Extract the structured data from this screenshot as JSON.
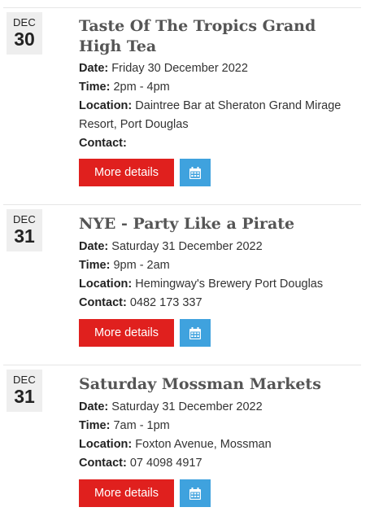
{
  "events": [
    {
      "month": "DEC",
      "day": "30",
      "title": "Taste Of The Tropics Grand High Tea",
      "date_label": "Date:",
      "date_value": "Friday 30 December 2022",
      "time_label": "Time:",
      "time_value": "2pm - 4pm",
      "location_label": "Location:",
      "location_value": "Daintree Bar at Sheraton Grand Mirage Resort, Port Douglas",
      "contact_label": "Contact:",
      "contact_value": "",
      "more_label": "More details",
      "calendar_icon": "calendar-icon"
    },
    {
      "month": "DEC",
      "day": "31",
      "title": "NYE - Party Like a Pirate",
      "date_label": "Date:",
      "date_value": "Saturday 31 December 2022",
      "time_label": "Time:",
      "time_value": "9pm - 2am",
      "location_label": "Location:",
      "location_value": "Hemingway's Brewery Port Douglas",
      "contact_label": "Contact:",
      "contact_value": "0482 173 337",
      "more_label": "More details",
      "calendar_icon": "calendar-icon"
    },
    {
      "month": "DEC",
      "day": "31",
      "title": "Saturday Mossman Markets",
      "date_label": "Date:",
      "date_value": "Saturday 31 December 2022",
      "time_label": "Time:",
      "time_value": "7am - 1pm",
      "location_label": "Location:",
      "location_value": "Foxton Avenue, Mossman",
      "contact_label": "Contact:",
      "contact_value": "07 4098 4917",
      "more_label": "More details",
      "calendar_icon": "calendar-icon"
    }
  ],
  "colors": {
    "more_button": "#e0201e",
    "calendar_button": "#3fa2de",
    "date_box": "#eeeeee",
    "title": "#555555"
  }
}
